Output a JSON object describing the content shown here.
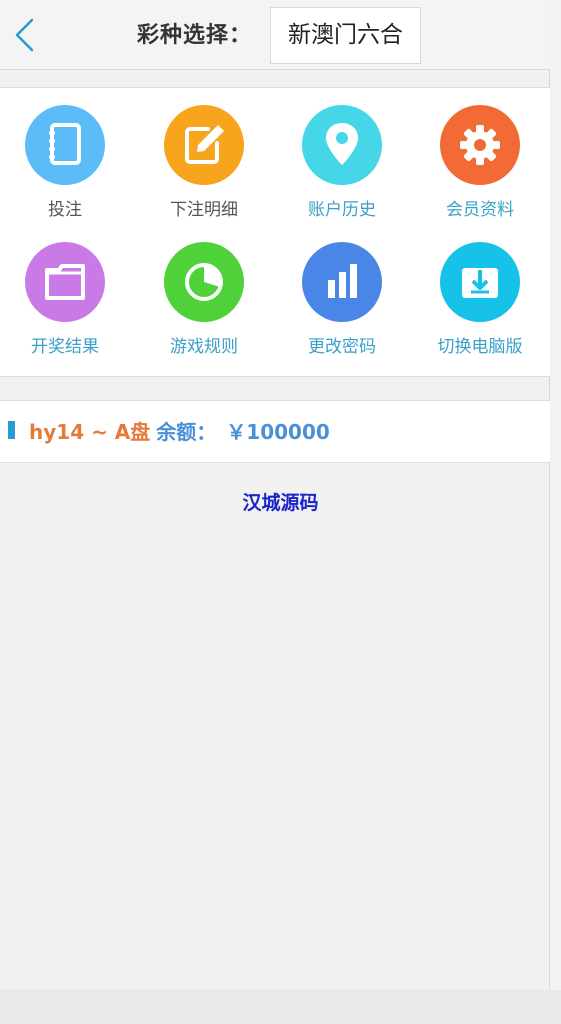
{
  "header": {
    "label": "彩种选择：",
    "selected_lottery": "新澳门六合"
  },
  "menu": {
    "items": [
      {
        "label": "投注",
        "icon": "notebook-icon",
        "color": "#5bbcf7"
      },
      {
        "label": "下注明细",
        "icon": "edit-icon",
        "color": "#f7a51c"
      },
      {
        "label": "账户历史",
        "icon": "location-pin-icon",
        "color": "#45d6e8"
      },
      {
        "label": "会员资料",
        "icon": "gear-icon",
        "color": "#f26a36"
      },
      {
        "label": "开奖结果",
        "icon": "folder-icon",
        "color": "#c97ae6"
      },
      {
        "label": "游戏规则",
        "icon": "pie-chart-icon",
        "color": "#4fd13a"
      },
      {
        "label": "更改密码",
        "icon": "bar-chart-icon",
        "color": "#4a86e8"
      },
      {
        "label": "切换电脑版",
        "icon": "download-icon",
        "color": "#17c2e8"
      }
    ]
  },
  "account": {
    "user": "hy14 ~ A盘",
    "balance_label": "余额：",
    "balance": "￥100000"
  },
  "watermark": "汉城源码",
  "colors": {
    "accent": "#2b9bd3",
    "user_text": "#e57a3c",
    "balance_text": "#4a90d9",
    "watermark": "#1a24c9"
  }
}
